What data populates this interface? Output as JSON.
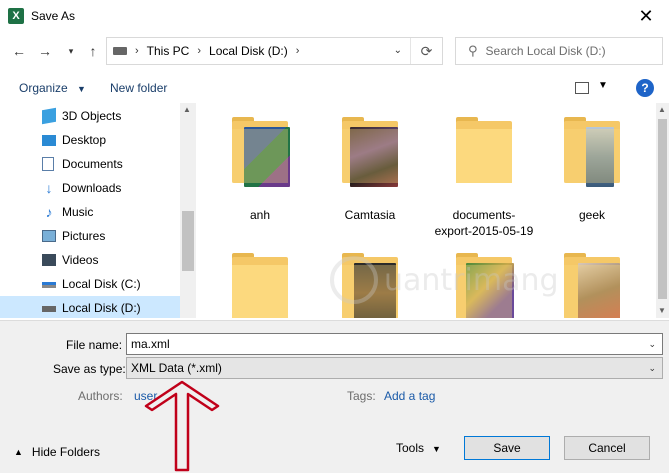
{
  "window": {
    "title": "Save As",
    "app_icon": "excel-icon",
    "close_glyph": "✕"
  },
  "navigation": {
    "address": [
      "This PC",
      "Local Disk (D:)"
    ],
    "search_placeholder": "Search Local Disk (D:)"
  },
  "toolbar": {
    "organize": "Organize",
    "new_folder": "New folder"
  },
  "nav_pane": {
    "items": [
      {
        "label": "3D Objects",
        "icon": "3d-objects-icon"
      },
      {
        "label": "Desktop",
        "icon": "desktop-icon"
      },
      {
        "label": "Documents",
        "icon": "documents-icon"
      },
      {
        "label": "Downloads",
        "icon": "downloads-icon"
      },
      {
        "label": "Music",
        "icon": "music-icon"
      },
      {
        "label": "Pictures",
        "icon": "pictures-icon"
      },
      {
        "label": "Videos",
        "icon": "videos-icon"
      },
      {
        "label": "Local Disk (C:)",
        "icon": "drive-icon"
      },
      {
        "label": "Local Disk (D:)",
        "icon": "drive-icon",
        "selected": true
      }
    ]
  },
  "files": {
    "items": [
      {
        "name": "anh"
      },
      {
        "name": "Camtasia"
      },
      {
        "name": "documents-export-2015-05-19"
      },
      {
        "name": "geek"
      },
      {
        "name": ""
      },
      {
        "name": ""
      },
      {
        "name": ""
      },
      {
        "name": ""
      }
    ]
  },
  "form": {
    "file_name_label": "File name:",
    "file_name_value": "ma.xml",
    "save_type_label": "Save as type:",
    "save_type_value": "XML Data (*.xml)",
    "authors_label": "Authors:",
    "authors_value": "user",
    "tags_label": "Tags:",
    "tags_value": "Add a tag"
  },
  "footer": {
    "hide_folders": "Hide Folders",
    "tools": "Tools",
    "save": "Save",
    "cancel": "Cancel"
  },
  "colors": {
    "selection": "#cce8ff",
    "folder": "#fcd97e",
    "link": "#1a5aa8",
    "annotation_arrow": "#c0001a"
  }
}
